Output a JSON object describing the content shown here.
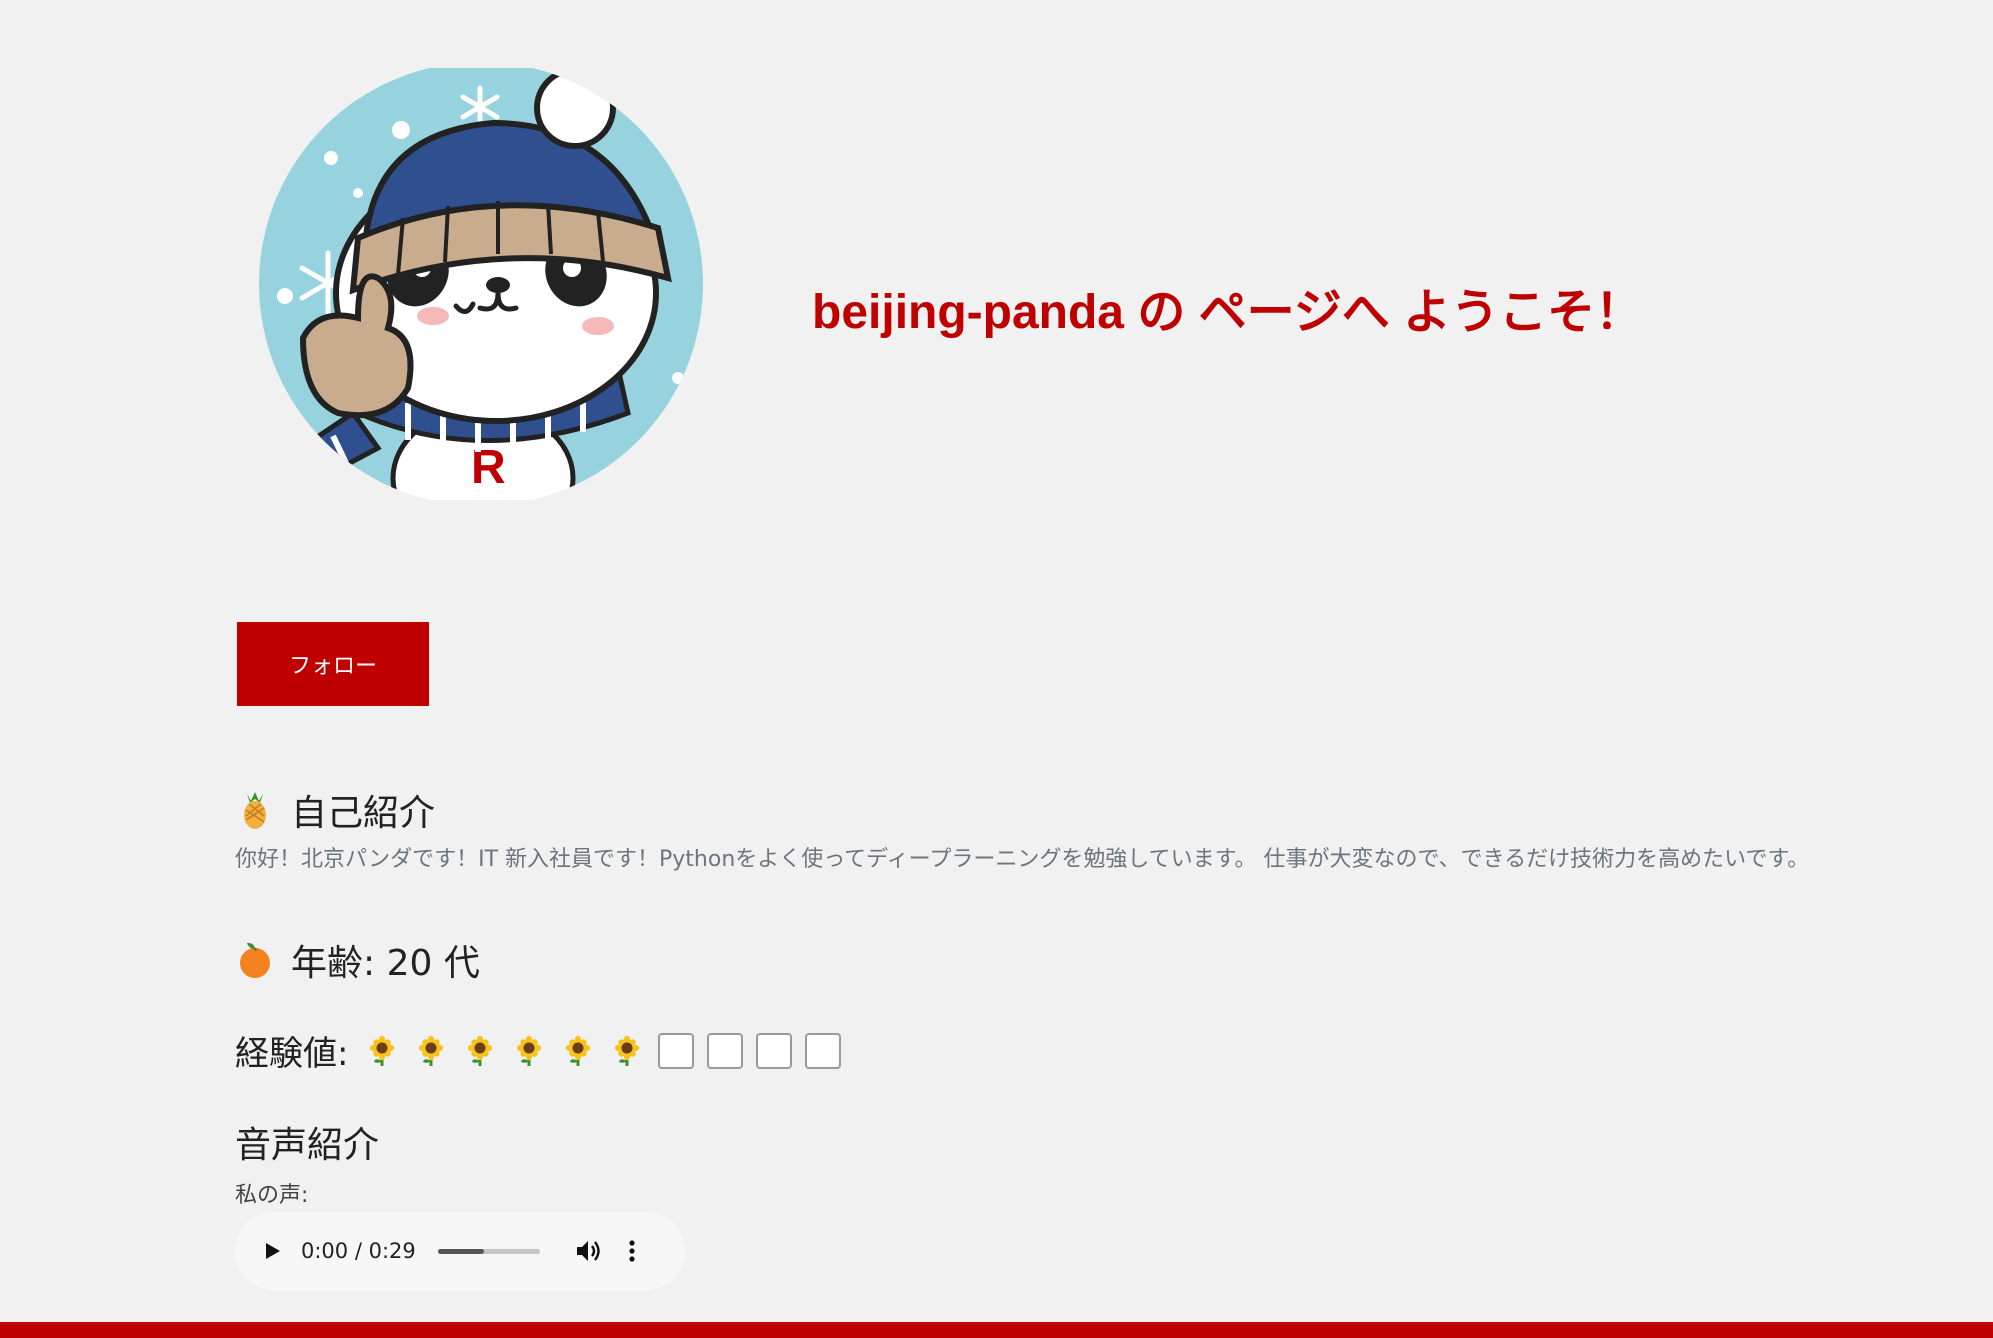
{
  "profile": {
    "welcome_text": "beijing-panda の ページへ ようこそ！",
    "follow_label": "フォロー"
  },
  "intro": {
    "icon": "pineapple-icon",
    "heading": "自己紹介",
    "text": "你好！北京パンダです！IT 新入社員です！Pythonをよく使ってディープラーニングを勉強しています。 仕事が大変なので、できるだけ技術力を高めたいです。"
  },
  "age": {
    "icon": "tangerine-icon",
    "heading": "年齢: 20 代"
  },
  "experience": {
    "label": "経験値:",
    "filled": 6,
    "total": 10,
    "filled_icon": "sunflower-icon"
  },
  "voice": {
    "heading": "音声紹介",
    "label": "私の声:",
    "time_text": "0:00 / 0:29",
    "progress": 0.45
  },
  "colors": {
    "accent": "#bf0000",
    "background": "#f1f1f1",
    "muted_text": "#6c757d"
  }
}
